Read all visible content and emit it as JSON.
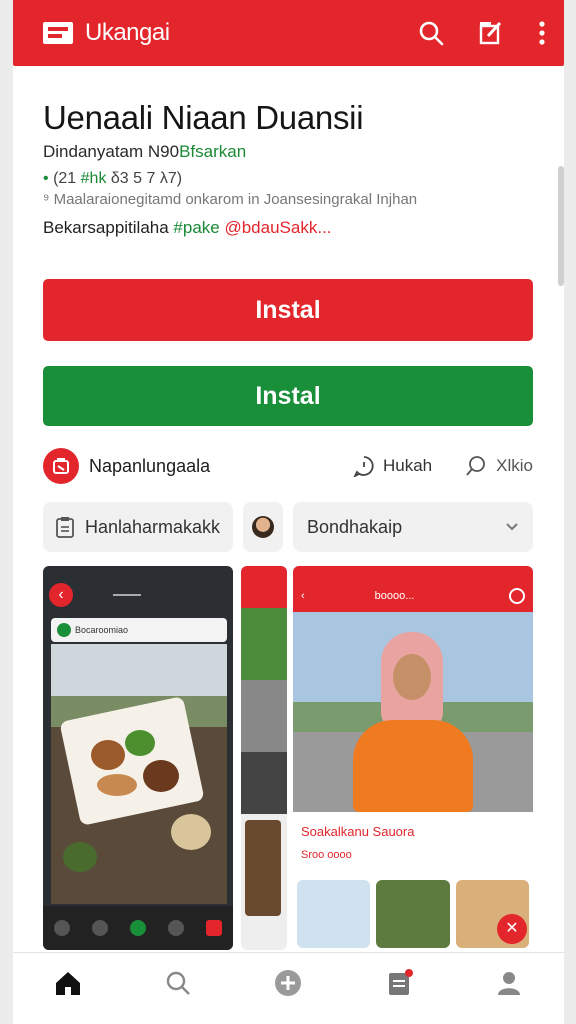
{
  "topbar": {
    "app_name": "Ukangai",
    "accent": "#e3262c",
    "actions": [
      "search-icon",
      "edit-icon",
      "more-vert-icon"
    ]
  },
  "app": {
    "title": "Uenaali Niaan Duansii",
    "subtitle_prefix": "Dindanyatam N90",
    "subtitle_green": "Bfsarkan",
    "meta_line": "(21 ",
    "meta_green": "#hk",
    "meta_rest": " δ3 5 7 λ7)",
    "description": "Maalaraionegitamd onkarom in Joansesingrakal Injhan",
    "tags_prefix": "Bekarsappitilaha ",
    "tag_green": "#pake",
    "tag_red": " @bdauSakk..."
  },
  "buttons": {
    "install_red": "Instal",
    "install_green": "Instal",
    "red": "#e3262c",
    "green": "#1a8f3a"
  },
  "developer": {
    "name": "Napanlungaala",
    "stat_a": "Hukah",
    "stat_b": "Xlkio"
  },
  "chips": {
    "chip1": "Hanlaharmakakk",
    "chip3": "Bondhakaip"
  },
  "screenshots": {
    "s1_card": "Bocaroomiao",
    "s3_header": "boooo...",
    "s3_name": "Soakalkanu Sauora",
    "s3_meta": "Sroo oooo"
  },
  "bottom_nav": [
    "home-icon",
    "search-icon",
    "add-icon",
    "library-icon",
    "profile-icon"
  ]
}
